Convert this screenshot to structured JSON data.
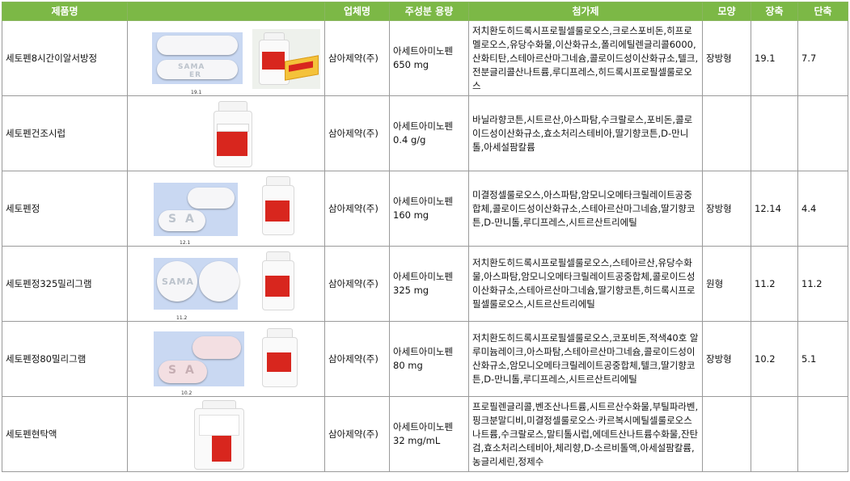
{
  "headers": {
    "name": "제품명",
    "image": "",
    "company": "업체명",
    "ingredient": "주성분 용량",
    "additives": "첨가제",
    "shape": "모양",
    "long_axis": "장축",
    "short_axis": "단축"
  },
  "rows": [
    {
      "name": "세토펜8시간이알서방정",
      "company": "삼아제약(주)",
      "ingredient": "아세트아미노펜",
      "dose": "650 mg",
      "additives": "저치환도히드록시프로필셀룰로오스,크로스포비돈,히프로멜로오스,유당수화물,이산화규소,폴리에틸렌글리콜6000,산화티탄,스테아르산마그네슘,콜로이드성이산화규소,텔크,전분글리콜산나트륨,루디프레스,히드록시프로필셀룰로오스",
      "shape": "장방형",
      "long": "19.1",
      "short": "7.7",
      "image_desc": "white-oblong-tablet-and-box"
    },
    {
      "name": "세토펜건조시럽",
      "company": "삼아제약(주)",
      "ingredient": "아세트아미노펜",
      "dose": "0.4 g/g",
      "additives": "바닐라향코튼,시트르산,아스파탐,수크랄로스,포비돈,콜로이드성이산화규소,효소처리스테비아,딸기향코튼,D-만니톨,아세설팜칼륨",
      "shape": "",
      "long": "",
      "short": "",
      "image_desc": "bottle"
    },
    {
      "name": "세토펜정",
      "company": "삼아제약(주)",
      "ingredient": "아세트아미노펜",
      "dose": "160 mg",
      "additives": "미결정셀룰로오스,아스파탐,암모니오메타크릴레이트공중합체,콜로이드성이산화규소,스테아르산마그네슘,딸기향코튼,D-만니톨,루디프레스,시트르산트리에틸",
      "shape": "장방형",
      "long": "12.14",
      "short": "4.4",
      "image_desc": "white-oblong-tablets-SA-and-bottle"
    },
    {
      "name": "세토펜정325밀리그램",
      "company": "삼아제약(주)",
      "ingredient": "아세트아미노펜",
      "dose": "325 mg",
      "additives": "저치환도히드록시프로필셀룰로오스,스테아르산,유당수화물,아스파탐,암모니오메타크릴레이트공중합체,콜로이드성이산화규소,스테아르산마그네슘,딸기향코튼,히드록시프로필셀룰로오스,시트르산트리에틸",
      "shape": "원형",
      "long": "11.2",
      "short": "11.2",
      "image_desc": "white-round-tablets-SAMA-and-bottle"
    },
    {
      "name": "세토펜정80밀리그램",
      "company": "삼아제약(주)",
      "ingredient": "아세트아미노펜",
      "dose": "80 mg",
      "additives": "저치환도히드록시프로필셀룰로오스,코포비돈,적색40호 알루미늄레이크,아스파탐,스테아르산마그네슘,콜로이드성이산화규소,암모니오메타크릴레이트공중합체,텔크,딸기향코튼,D-만니톨,루디프레스,시트르산트리에틸",
      "shape": "장방형",
      "long": "10.2",
      "short": "5.1",
      "image_desc": "pink-oblong-tablets-SA-and-bottle"
    },
    {
      "name": "세토펜현탁액",
      "company": "삼아제약(주)",
      "ingredient": "아세트아미노펜",
      "dose": "32 mg/mL",
      "additives": "프로필렌글리콜,벤조산나트륨,시트르산수화물,부틸파라벤,핑크분말디비,미결정셀룰로오스·카르복시메틸셀룰로오스나트륨,수크랄로스,말티톨시럽,에데트산나트륨수화물,잔탄검,효소처리스테비아,체리향,D-소르비톨액,아세설팜칼륨,농글리세린,정제수",
      "shape": "",
      "long": "",
      "short": "",
      "image_desc": "suspension-bottle"
    }
  ],
  "image_text": {
    "r1_engr1": "SAMA",
    "r1_engr2": "ER",
    "r1_dim": "19.1",
    "r3_engr": "S A",
    "r3_dim": "12.1",
    "r4_engr": "SAMA",
    "r4_dim": "11.2",
    "r5_engr": "S A",
    "r5_dim": "10.2"
  },
  "colors": {
    "header_bg": "#7cb846",
    "header_text": "#ffffff",
    "grid": "#9a9a9a",
    "pill_panel": "#c9d8f2",
    "label_red": "#d8261e"
  }
}
